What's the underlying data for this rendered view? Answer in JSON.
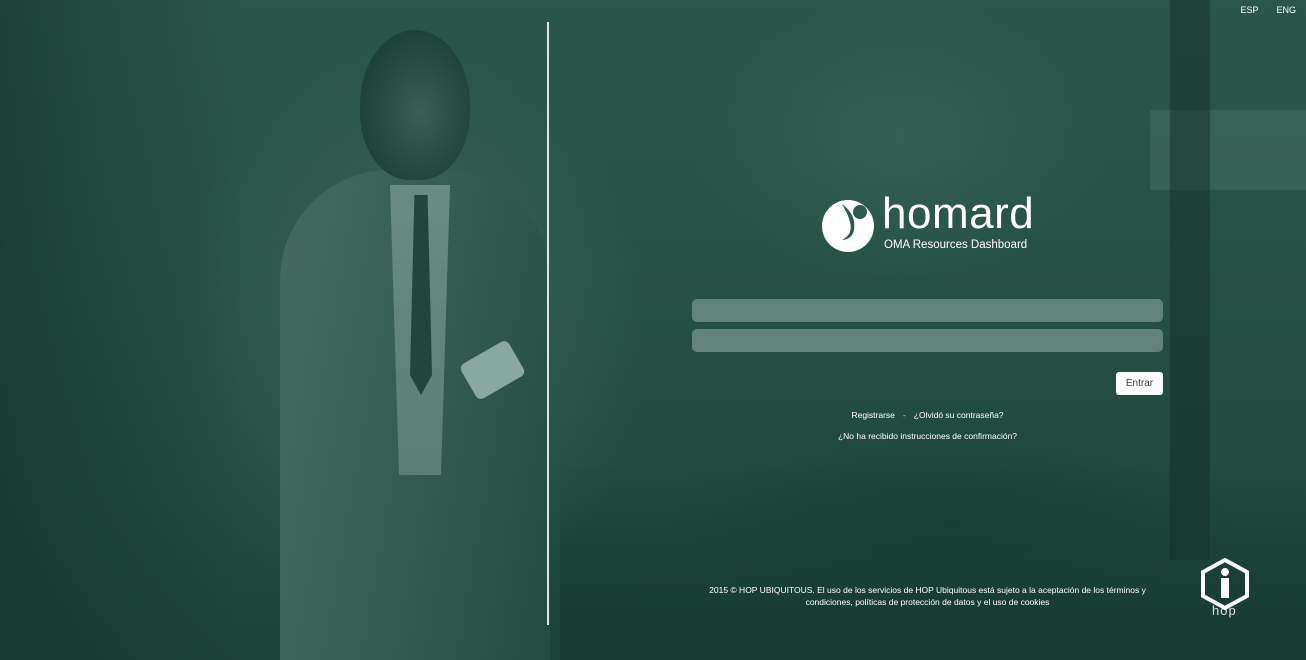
{
  "language": {
    "options": [
      "ESP",
      "ENG"
    ]
  },
  "brand": {
    "name": "homard",
    "subtitle": "OMA Resources Dashboard",
    "footer_logo_text": "hop"
  },
  "form": {
    "username_value": "",
    "password_value": "",
    "submit_label": "Entrar"
  },
  "links": {
    "register": "Registrarse",
    "separator": "-",
    "forgot_password": "¿Olvidó su contraseña?",
    "no_confirmation": "¿No ha recibido instrucciones de confirmación?"
  },
  "footer": {
    "line1": "2015 © HOP UBIQUITOUS. El uso de los servicios de HOP Ubiquitous está sujeto a la aceptación de los términos y",
    "line2": "condiciones, políticas de protección de datos y el uso de cookies"
  },
  "colors": {
    "overlay": "#185042",
    "text": "#ffffff",
    "button_bg": "#ffffff",
    "field_bg": "#c8d7d2"
  }
}
